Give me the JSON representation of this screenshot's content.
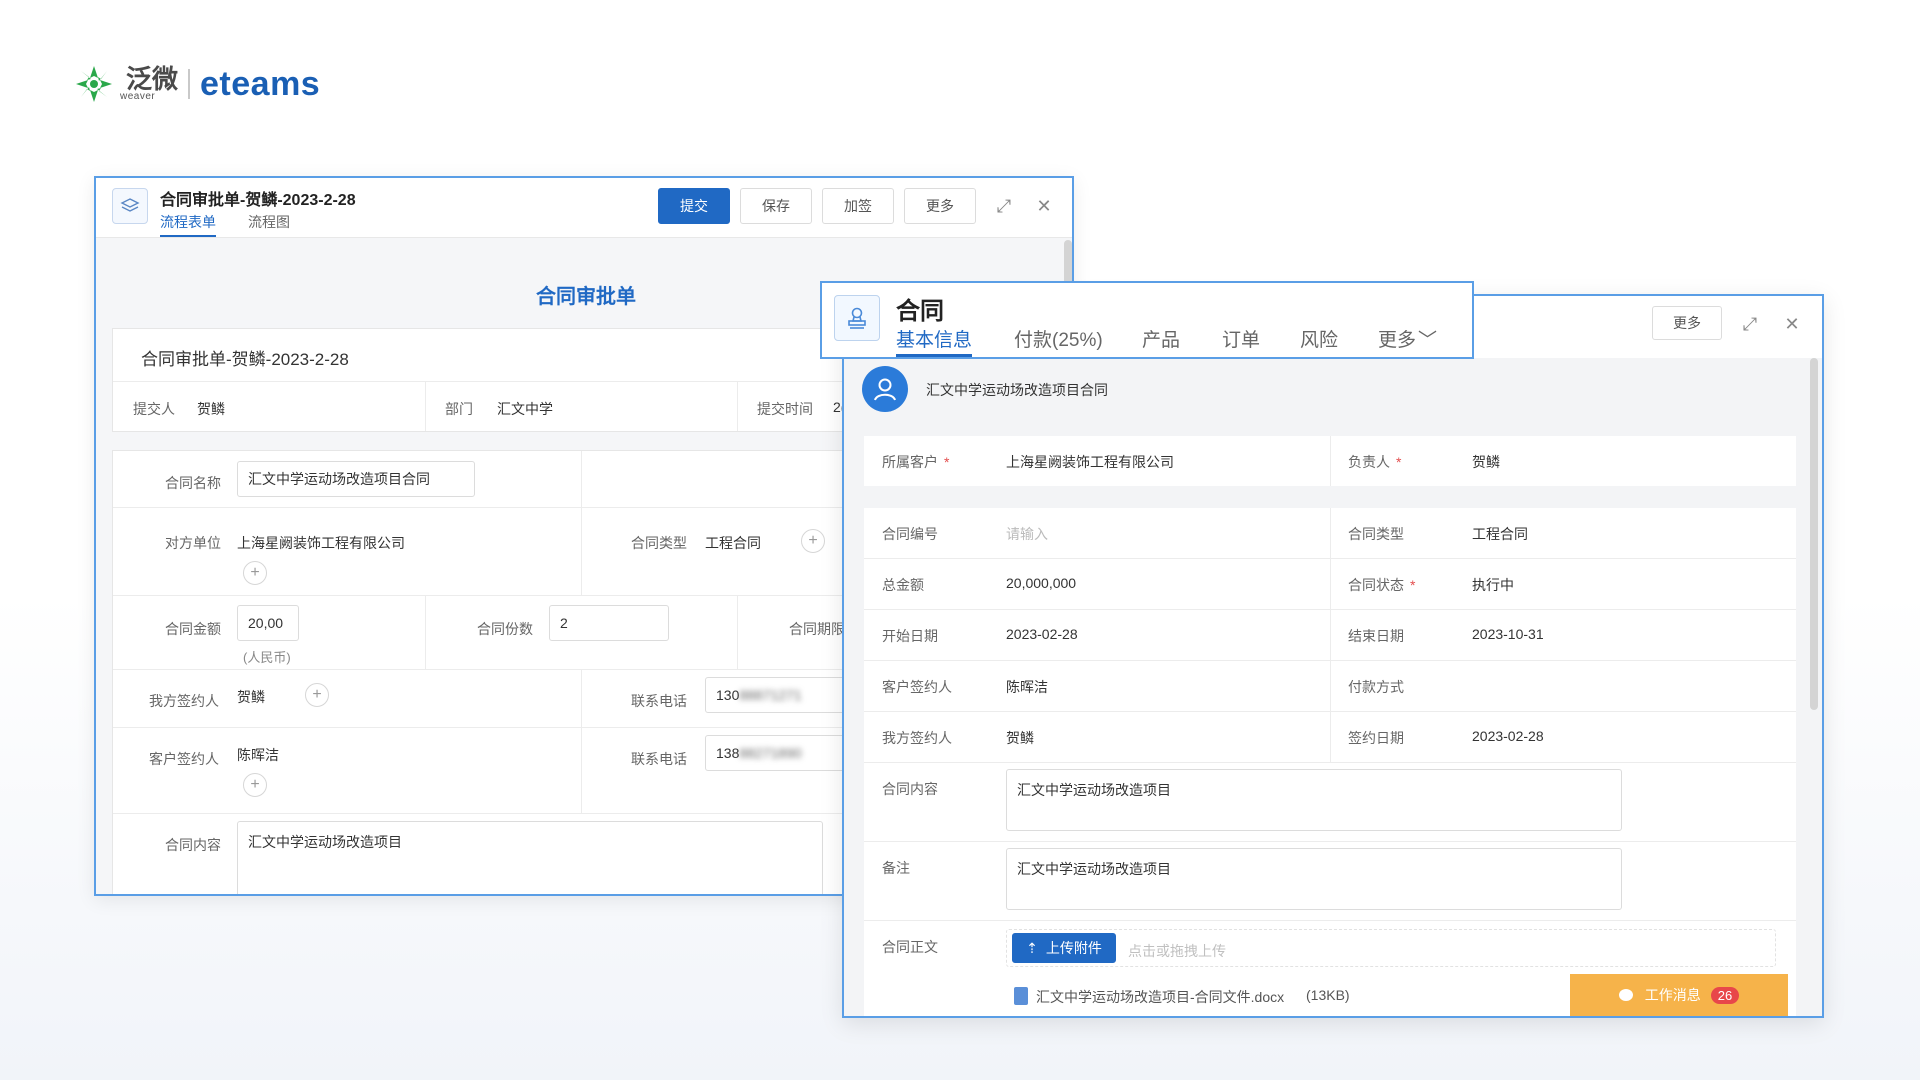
{
  "brand": {
    "name_cn": "泛微",
    "name_en": "weaver",
    "product": "eteams"
  },
  "approval_window": {
    "title": "合同审批单-贺鳞-2023-2-28",
    "tabs": [
      "流程表单",
      "流程图"
    ],
    "buttons": {
      "submit": "提交",
      "save": "保存",
      "countersign": "加签",
      "more": "更多"
    },
    "form_title": "合同审批单",
    "doc_name": "合同审批单-贺鳞-2023-2-28",
    "meta": {
      "submitter_label": "提交人",
      "submitter": "贺鳞",
      "dept_label": "部门",
      "dept": "汇文中学",
      "time_label": "提交时间",
      "time_partial": "2("
    },
    "fields": {
      "contract_name_label": "合同名称",
      "contract_name": "汇文中学运动场改造项目合同",
      "counterparty_label": "对方单位",
      "counterparty": "上海星阙装饰工程有限公司",
      "type_label": "合同类型",
      "type": "工程合同",
      "amount_label": "合同金额",
      "amount": "20,00",
      "currency": "(人民币)",
      "copies_label": "合同份数",
      "copies": "2",
      "period_label": "合同期限",
      "our_signer_label": "我方签约人",
      "our_signer": "贺鳞",
      "phone_label": "联系电话",
      "phone1": "130",
      "phone1_hidden": "88871271",
      "client_signer_label": "客户签约人",
      "client_signer": "陈晖洁",
      "phone2": "138",
      "phone2_hidden": "88271890",
      "content_label": "合同内容",
      "content": "汇文中学运动场改造项目"
    }
  },
  "contract_window": {
    "title": "合同",
    "tabs": [
      "基本信息",
      "付款(25%)",
      "产品",
      "订单",
      "风险",
      "更多"
    ],
    "more_button": "更多",
    "project_name": "汇文中学运动场改造项目合同",
    "rows": {
      "client_label": "所属客户",
      "client": "上海星阙装饰工程有限公司",
      "owner_label": "负责人",
      "owner": "贺鳞",
      "number_label": "合同编号",
      "number_placeholder": "请输入",
      "type_label": "合同类型",
      "type": "工程合同",
      "total_label": "总金额",
      "total": "20,000,000",
      "status_label": "合同状态",
      "status": "执行中",
      "start_label": "开始日期",
      "start": "2023-02-28",
      "end_label": "结束日期",
      "end": "2023-10-31",
      "client_signer_label": "客户签约人",
      "client_signer": "陈晖洁",
      "payment_label": "付款方式",
      "our_signer_label": "我方签约人",
      "our_signer": "贺鳞",
      "sign_date_label": "签约日期",
      "sign_date": "2023-02-28",
      "content_label": "合同内容",
      "content": "汇文中学运动场改造项目",
      "remark_label": "备注",
      "remark": "汇文中学运动场改造项目",
      "body_label": "合同正文",
      "upload_button": "上传附件",
      "upload_hint": "点击或拖拽上传",
      "file_name": "汇文中学运动场改造项目-合同文件.docx",
      "file_size": "(13KB)"
    },
    "work_msg": {
      "label": "工作消息",
      "count": "26"
    }
  },
  "colors": {
    "accent": "#2069c4",
    "required": "#e34d4d",
    "work_msg_bg": "#f6b34a",
    "badge": "#e8474a"
  }
}
